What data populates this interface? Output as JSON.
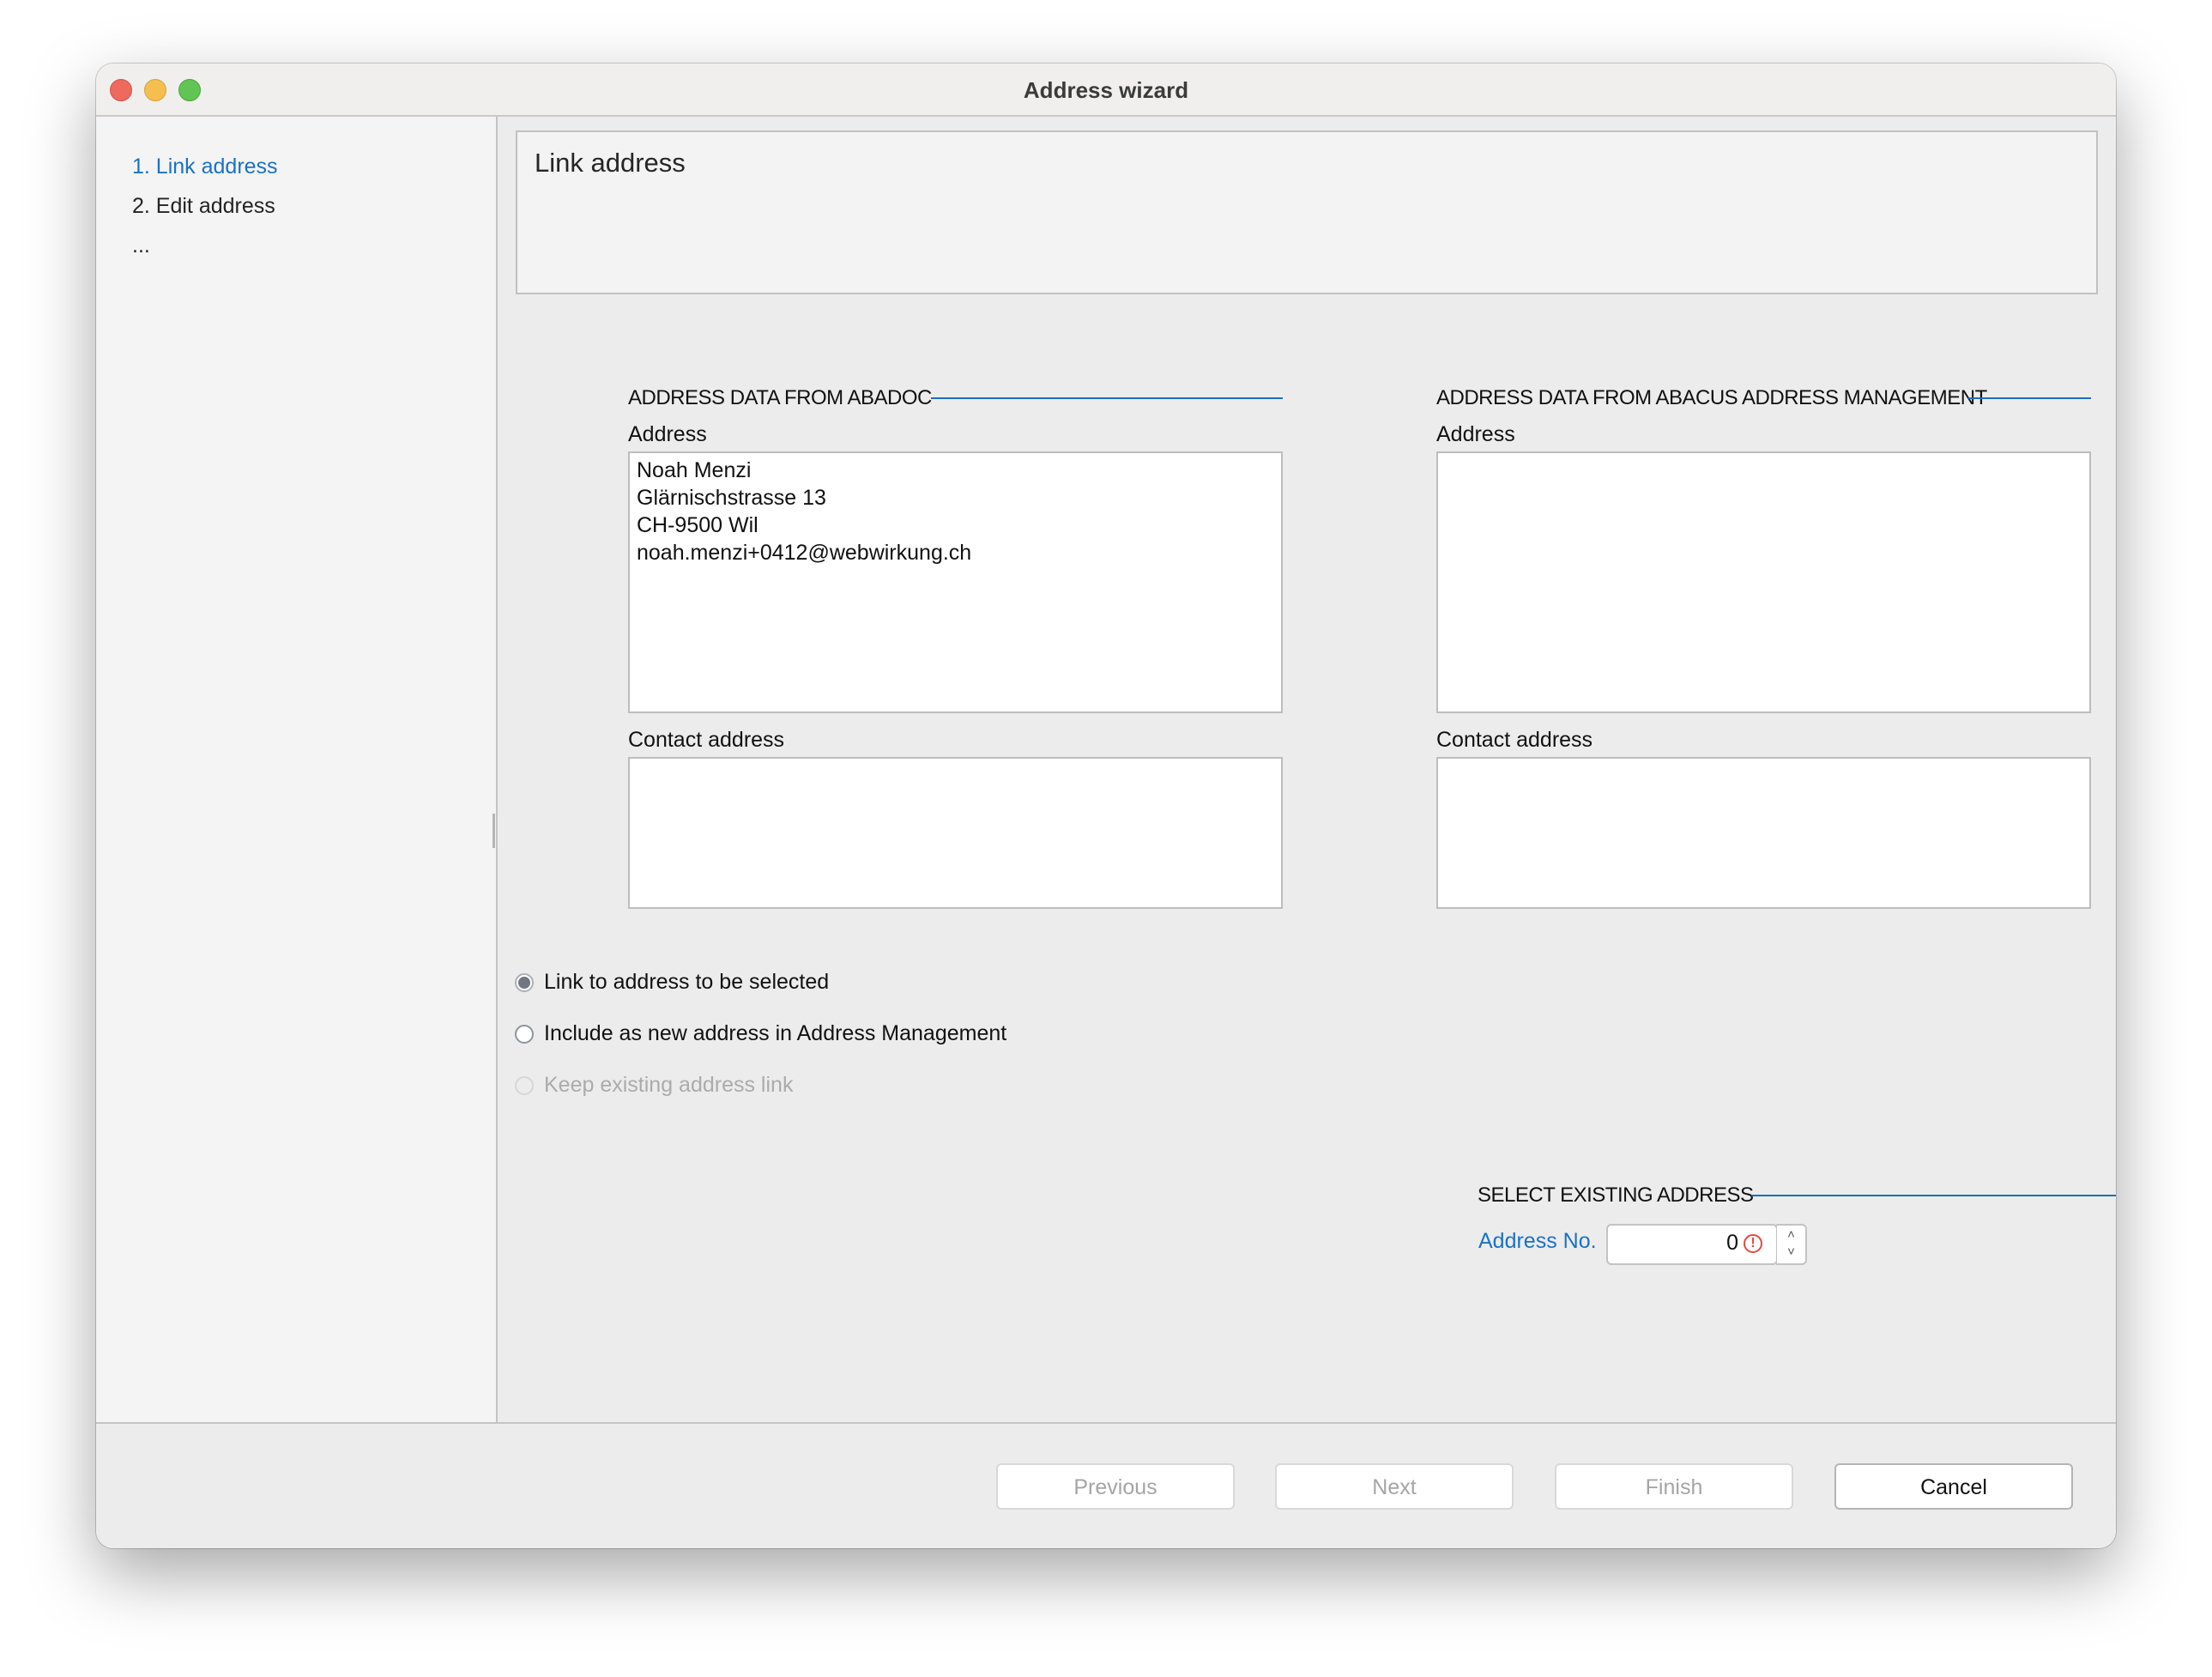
{
  "window": {
    "title": "Address wizard"
  },
  "sidebar": {
    "steps": [
      {
        "label": "1. Link address",
        "active": true
      },
      {
        "label": "2. Edit address",
        "active": false
      },
      {
        "label": "...",
        "active": false
      }
    ]
  },
  "header": {
    "title": "Link address"
  },
  "left_section": {
    "title": "ADDRESS DATA FROM ABADOC",
    "address_label": "Address",
    "address_lines": [
      "Noah Menzi",
      "Glärnischstrasse 13",
      "CH-9500 Wil",
      "noah.menzi+0412@webwirkung.ch"
    ],
    "contact_label": "Contact address",
    "contact_value": ""
  },
  "right_section": {
    "title": "ADDRESS DATA FROM ABACUS ADDRESS MANAGEMENT",
    "address_label": "Address",
    "address_value": "",
    "contact_label": "Contact address",
    "contact_value": ""
  },
  "options": [
    {
      "label": "Link to address to be selected",
      "checked": true,
      "disabled": false
    },
    {
      "label": "Include as new address in Address Management",
      "checked": false,
      "disabled": false
    },
    {
      "label": "Keep existing address link",
      "checked": false,
      "disabled": true
    }
  ],
  "select_existing": {
    "title": "SELECT EXISTING ADDRESS",
    "address_no_label": "Address No.",
    "address_no_value": "0",
    "warning_icon": "!",
    "stepper_up": "˄",
    "stepper_down": "˅"
  },
  "footer": {
    "previous_label": "Previous",
    "next_label": "Next",
    "finish_label": "Finish",
    "cancel_label": "Cancel"
  },
  "colors": {
    "accent": "#1a72c4",
    "section_line": "#1a6fbf",
    "warning": "#e5493f"
  }
}
